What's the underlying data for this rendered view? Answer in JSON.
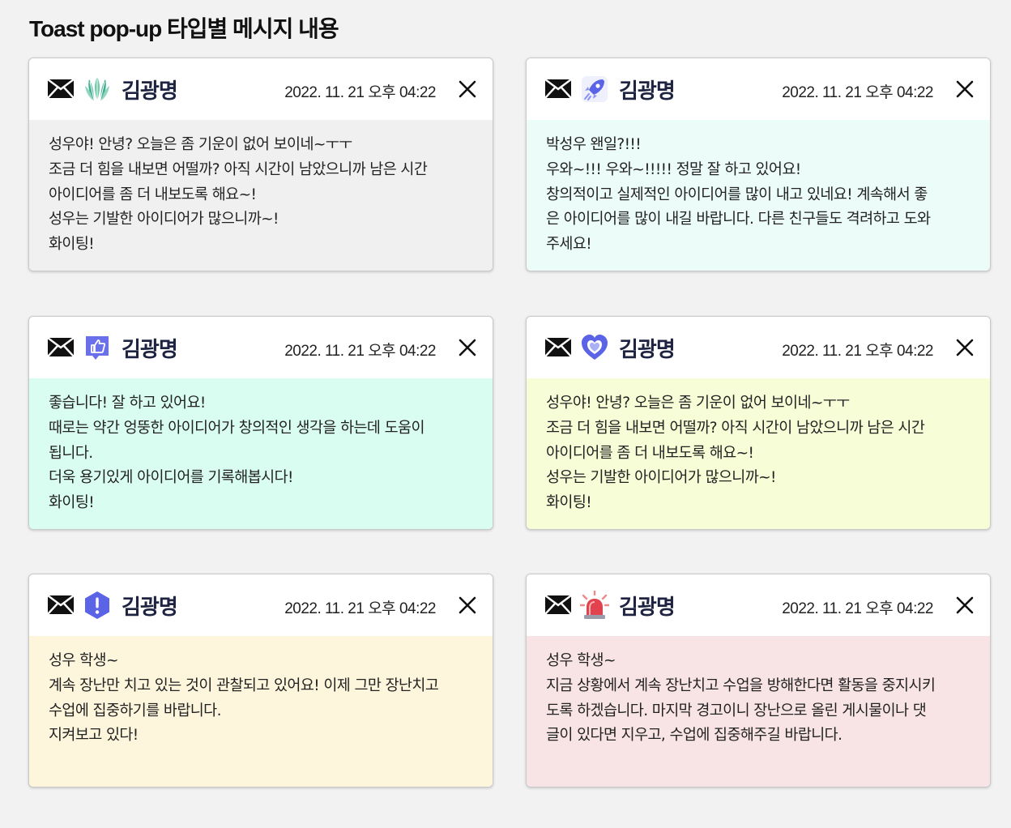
{
  "page": {
    "title": "Toast pop-up 타입별 메시지 내용"
  },
  "toasts": [
    {
      "sender": "김광명",
      "timestamp": "2022. 11. 21  오후 04:22",
      "avatar": "leaf-icon",
      "bg": "#f0f0f0",
      "lines": [
        "성우야! 안녕? 오늘은 좀 기운이 없어 보이네~ㅜㅜ",
        "조금 더 힘을 내보면 어떨까? 아직 시간이 남았으니까 남은 시간",
        "아이디어를 좀 더 내보도록 해요~!",
        "성우는 기발한 아이디어가 많으니까~!",
        "화이팅!"
      ]
    },
    {
      "sender": "김광명",
      "timestamp": "2022. 11. 21  오후 04:22",
      "avatar": "rocket-icon",
      "bg": "#ecfcf9",
      "lines": [
        "박성우 왠일?!!!",
        "우와~!!! 우와~!!!!! 정말 잘 하고 있어요!",
        "창의적이고 실제적인 아이디어를 많이 내고 있네요! 계속해서 좋",
        "은 아이디어를 많이 내길 바랍니다. 다른 친구들도 격려하고 도와",
        "주세요!"
      ]
    },
    {
      "sender": "김광명",
      "timestamp": "2022. 11. 21  오후 04:22",
      "avatar": "thumbs-up-icon",
      "bg": "#dafdf2",
      "lines": [
        "좋습니다! 잘 하고 있어요!",
        "때로는 약간 엉뚱한 아이디어가 창의적인 생각을 하는데 도움이",
        "됩니다.",
        "더욱 용기있게 아이디어를 기록해봅시다!",
        "화이팅!"
      ]
    },
    {
      "sender": "김광명",
      "timestamp": "2022. 11. 21  오후 04:22",
      "avatar": "heart-icon",
      "bg": "#f7fdd6",
      "lines": [
        "성우야! 안녕? 오늘은 좀 기운이 없어 보이네~ㅜㅜ",
        "조금 더 힘을 내보면 어떨까? 아직 시간이 남았으니까 남은 시간",
        "아이디어를 좀 더 내보도록 해요~!",
        "성우는 기발한 아이디어가 많으니까~!",
        "화이팅!"
      ]
    },
    {
      "sender": "김광명",
      "timestamp": "2022. 11. 21  오후 04:22",
      "avatar": "warning-hexagon-icon",
      "bg": "#fdf5dc",
      "lines": [
        "성우 학생~",
        "계속 장난만 치고 있는 것이 관찰되고 있어요! 이제 그만 장난치고",
        "수업에 집중하기를 바랍니다.",
        "지켜보고 있다!"
      ]
    },
    {
      "sender": "김광명",
      "timestamp": "2022. 11. 21  오후 04:22",
      "avatar": "siren-icon",
      "bg": "#f9e4e5",
      "lines": [
        "성우 학생~",
        "지금 상황에서 계속 장난치고 수업을 방해한다면 활동을 중지시키",
        "도록 하겠습니다. 마지막 경고이니 장난으로 올린 게시물이나 댓",
        "글이 있다면 지우고, 수업에 집중해주길 바랍니다."
      ]
    }
  ]
}
